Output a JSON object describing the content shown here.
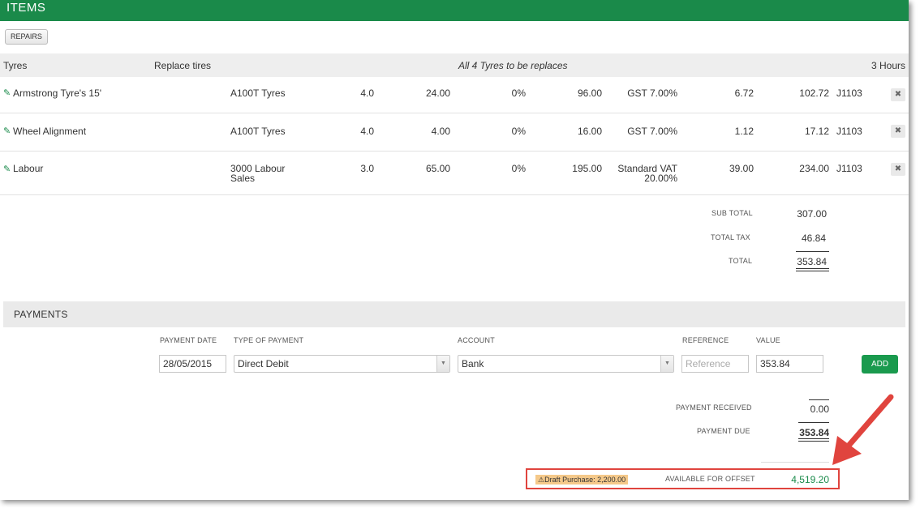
{
  "header": {
    "title": "ITEMS"
  },
  "toolbar": {
    "repairs_label": "REPAIRS"
  },
  "group": {
    "category": "Tyres",
    "task": "Replace tires",
    "note": "All 4 Tyres to be replaces",
    "hours": "3 Hours"
  },
  "items": [
    {
      "name": "Armstrong Tyre's 15'",
      "account": "A100T Tyres",
      "qty": "4.0",
      "price": "24.00",
      "discount": "0%",
      "amount": "96.00",
      "tax_rate": "GST 7.00%",
      "tax": "6.72",
      "total": "102.72",
      "job": "J1103"
    },
    {
      "name": "Wheel Alignment",
      "account": "A100T Tyres",
      "qty": "4.0",
      "price": "4.00",
      "discount": "0%",
      "amount": "16.00",
      "tax_rate": "GST 7.00%",
      "tax": "1.12",
      "total": "17.12",
      "job": "J1103"
    },
    {
      "name": "Labour",
      "account": "3000 Labour Sales",
      "account_line1": "3000 Labour",
      "account_line2": "Sales",
      "qty": "3.0",
      "price": "65.00",
      "discount": "0%",
      "amount": "195.00",
      "tax_rate_line1": "Standard VAT",
      "tax_rate_line2": "20.00%",
      "tax": "39.00",
      "total": "234.00",
      "job": "J1103"
    }
  ],
  "totals": {
    "subtotal_label": "SUB TOTAL",
    "subtotal": "307.00",
    "tax_label": "TOTAL TAX",
    "tax": "46.84",
    "total_label": "TOTAL",
    "total": "353.84"
  },
  "payments": {
    "title": "PAYMENTS",
    "columns": {
      "date": "PAYMENT DATE",
      "type": "TYPE OF PAYMENT",
      "account": "ACCOUNT",
      "reference": "REFERENCE",
      "value": "VALUE"
    },
    "date_value": "28/05/2015",
    "type_value": "Direct Debit",
    "account_value": "Bank",
    "reference_placeholder": "Reference",
    "value_value": "353.84",
    "add_label": "ADD",
    "received_label": "PAYMENT RECEIVED",
    "received": "0.00",
    "due_label": "PAYMENT DUE",
    "due": "353.84"
  },
  "offset": {
    "draft_badge": "Draft Purchase: 2,200.00",
    "label": "AVAILABLE FOR OFFSET",
    "value": "4,519.20"
  },
  "colors": {
    "brand_green": "#1a8a4a",
    "highlight_red": "#e0443e",
    "badge_orange": "#f5c98a"
  },
  "icons": {
    "edit": "pencil-icon",
    "delete": "close-icon",
    "select": "chevron-down-icon",
    "warning": "warning-icon",
    "annotation": "arrow-annotation"
  }
}
